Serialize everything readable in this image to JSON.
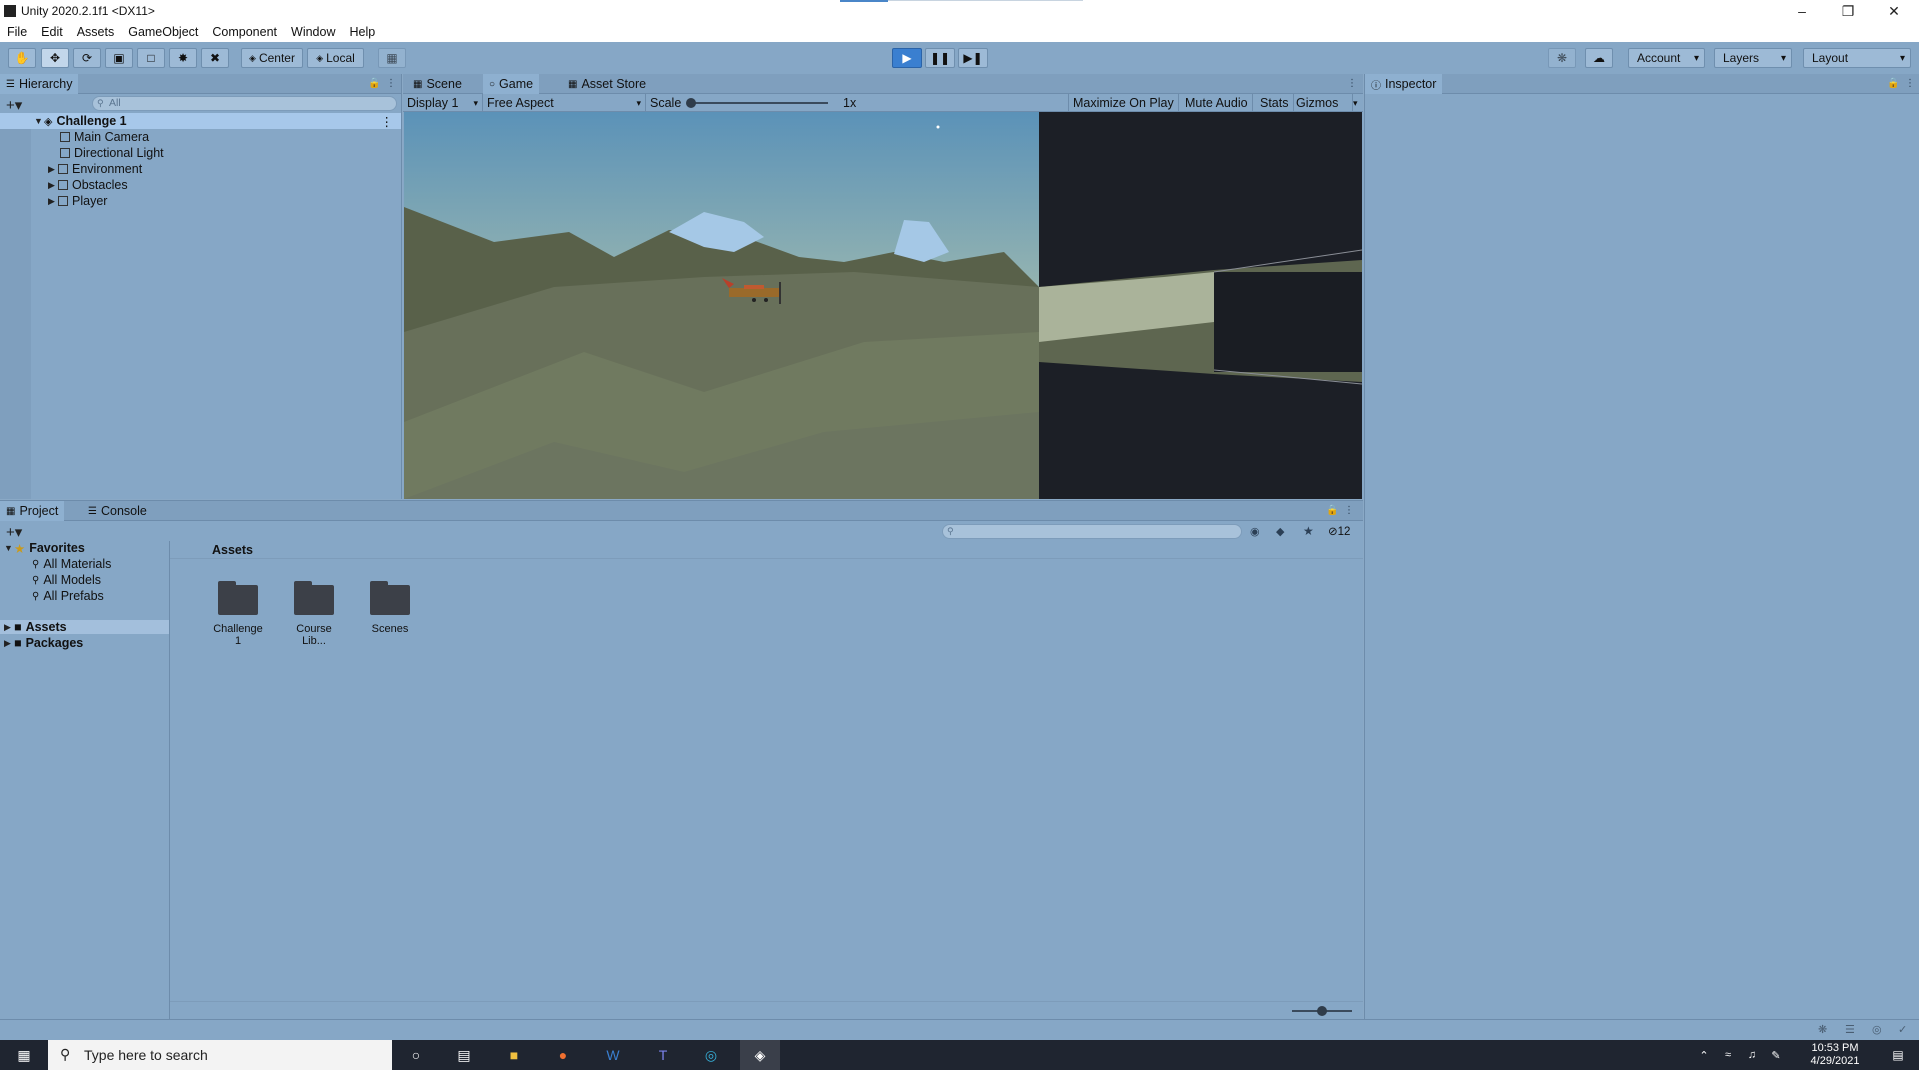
{
  "window": {
    "title": "Unity 2020.2.1f1 <DX11>"
  },
  "menu": [
    "File",
    "Edit",
    "Assets",
    "GameObject",
    "Component",
    "Window",
    "Help"
  ],
  "toolbar": {
    "pivot_label": "Center",
    "space_label": "Local",
    "account_label": "Account",
    "layers_label": "Layers",
    "layout_label": "Layout"
  },
  "hierarchy": {
    "tab": "Hierarchy",
    "search_placeholder": "All",
    "scene": "Challenge 1",
    "items": [
      "Main Camera",
      "Directional Light",
      "Environment",
      "Obstacles",
      "Player"
    ]
  },
  "center_tabs": [
    "Scene",
    "Game",
    "Asset Store"
  ],
  "game_toolbar": {
    "display": "Display 1",
    "aspect": "Free Aspect",
    "scale_label": "Scale",
    "scale_value": "1x",
    "maximize": "Maximize On Play",
    "mute": "Mute Audio",
    "stats": "Stats",
    "gizmos": "Gizmos"
  },
  "inspector": {
    "tab": "Inspector"
  },
  "project": {
    "tabs": [
      "Project",
      "Console"
    ],
    "favorites_label": "Favorites",
    "favorites": [
      "All Materials",
      "All Models",
      "All Prefabs"
    ],
    "roots": [
      "Assets",
      "Packages"
    ],
    "breadcrumb": "Assets",
    "hidden_count": "12",
    "folders": [
      "Challenge 1",
      "Course Lib...",
      "Scenes"
    ]
  },
  "taskbar": {
    "search_placeholder": "Type here to search",
    "time": "10:53 PM",
    "date": "4/29/2021"
  }
}
